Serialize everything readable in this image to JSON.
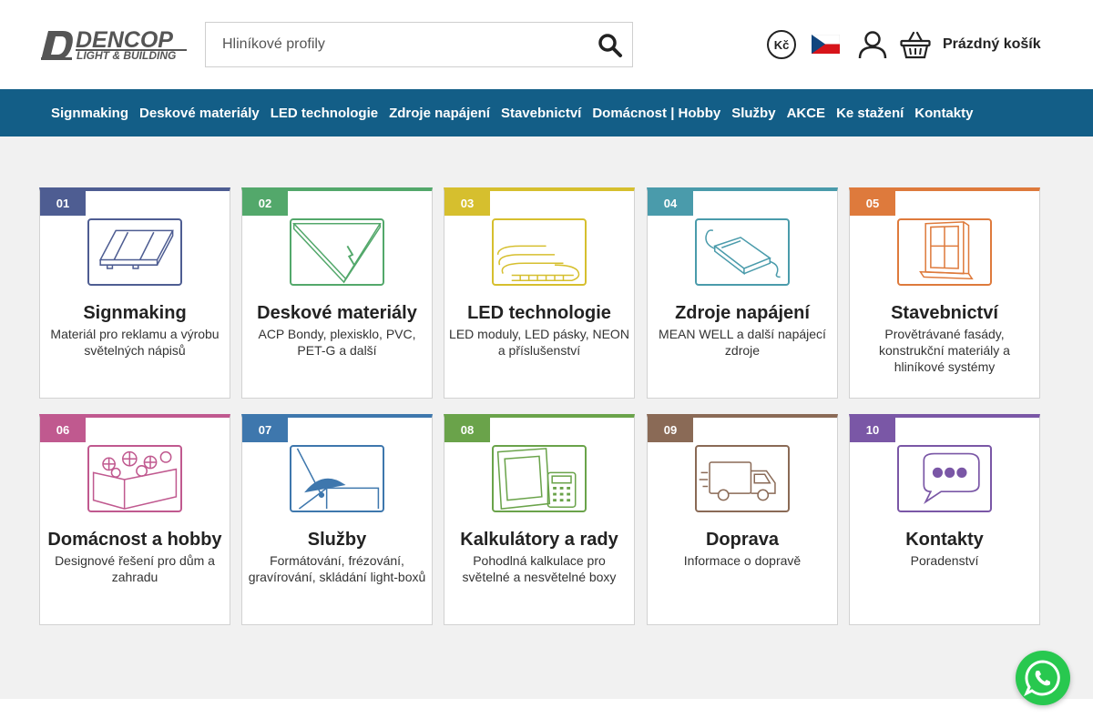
{
  "header": {
    "logo_text": "DENCOP",
    "logo_subtext": "LIGHT & BUILDING",
    "search_placeholder": "Hliníkové profily",
    "currency": "Kč",
    "cart_label": "Prázdný košík"
  },
  "nav": [
    "Signmaking",
    "Deskové materiály",
    "LED technologie",
    "Zdroje napájení",
    "Stavebnictví",
    "Domácnost | Hobby",
    "Služby",
    "AKCE",
    "Ke stažení",
    "Kontakty"
  ],
  "cards": [
    {
      "num": "01",
      "title": "Signmaking",
      "desc": "Materiál pro reklamu a výrobu světelných nápisů",
      "color": "#4e5d92",
      "icon": "aluminium-profile-icon"
    },
    {
      "num": "02",
      "title": "Deskové materiály",
      "desc": "ACP Bondy, plexisklo, PVC, PET-G a další",
      "color": "#53a86b",
      "icon": "board-sheet-icon"
    },
    {
      "num": "03",
      "title": "LED technologie",
      "desc": "LED moduly, LED pásky, NEON a příslušenství",
      "color": "#d6bf2e",
      "icon": "led-strip-icon"
    },
    {
      "num": "04",
      "title": "Zdroje napájení",
      "desc": "MEAN WELL a další napájecí zdroje",
      "color": "#4a9bab",
      "icon": "power-supply-icon"
    },
    {
      "num": "05",
      "title": "Stavebnictví",
      "desc": "Provětrávané fasády, konstrukční materiály a hliníkové systémy",
      "color": "#de7a3c",
      "icon": "window-frame-icon"
    },
    {
      "num": "06",
      "title": "Domácnost a hobby",
      "desc": "Designové řešení pro dům a zahradu",
      "color": "#c0598f",
      "icon": "flower-planter-icon"
    },
    {
      "num": "07",
      "title": "Služby",
      "desc": "Formátování, frézování, gravírování, skládání light-boxů",
      "color": "#3e77ad",
      "icon": "saw-cutting-icon"
    },
    {
      "num": "08",
      "title": "Kalkulátory a rady",
      "desc": "Pohodlná kalkulace pro světelné a nesvětelné boxy",
      "color": "#6aa34a",
      "icon": "calculator-icon"
    },
    {
      "num": "09",
      "title": "Doprava",
      "desc": "Informace o dopravě",
      "color": "#8a6a56",
      "icon": "delivery-truck-icon"
    },
    {
      "num": "10",
      "title": "Kontakty",
      "desc": "Poradenství",
      "color": "#7a57a6",
      "icon": "chat-bubble-icon"
    }
  ]
}
